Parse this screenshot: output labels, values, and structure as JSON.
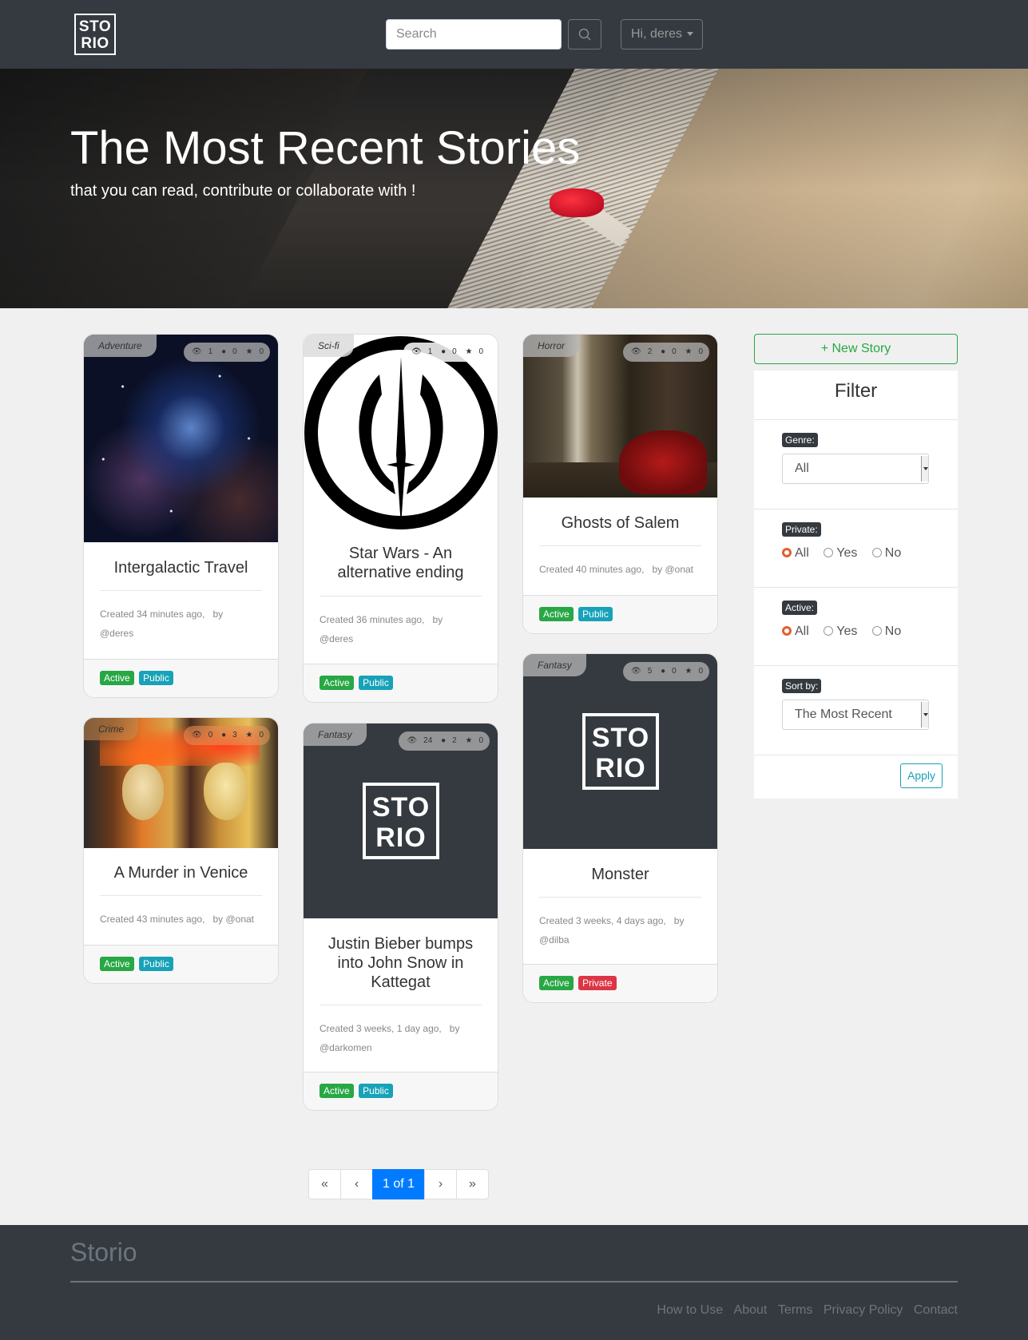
{
  "navbar": {
    "logo_line1": "STO",
    "logo_line2": "RIO",
    "search_placeholder": "Search",
    "user_label": "Hi, deres"
  },
  "hero": {
    "title": "The Most Recent Stories",
    "subtitle": "that you can read, contribute or collaborate with !"
  },
  "cards": [
    {
      "genre": "Adventure",
      "views": "1",
      "comments": "0",
      "stars": "0",
      "title": "Intergalactic Travel",
      "created": "Created 34 minutes ago,",
      "by": "by",
      "author": "@deres",
      "badges": [
        "Active",
        "Public"
      ]
    },
    {
      "genre": "Sci-fi",
      "views": "1",
      "comments": "0",
      "stars": "0",
      "title": "Star Wars - An alternative ending",
      "created": "Created 36 minutes ago,",
      "by": "by",
      "author": "@deres",
      "badges": [
        "Active",
        "Public"
      ]
    },
    {
      "genre": "Horror",
      "views": "2",
      "comments": "0",
      "stars": "0",
      "title": "Ghosts of Salem",
      "created": "Created 40 minutes ago,",
      "by": "by",
      "author": "@onat",
      "badges": [
        "Active",
        "Public"
      ]
    },
    {
      "genre": "Crime",
      "views": "0",
      "comments": "3",
      "stars": "0",
      "title": "A Murder in Venice",
      "created": "Created 43 minutes ago,",
      "by": "by",
      "author": "@onat",
      "badges": [
        "Active",
        "Public"
      ]
    },
    {
      "genre": "Fantasy",
      "views": "24",
      "comments": "2",
      "stars": "0",
      "title": "Justin Bieber bumps into John Snow in Kattegat",
      "created": "Created 3 weeks, 1 day ago,",
      "by": "by",
      "author": "@darkomen",
      "badges": [
        "Active",
        "Public"
      ],
      "logo_line1": "STO",
      "logo_line2": "RIO"
    },
    {
      "genre": "Fantasy",
      "views": "5",
      "comments": "0",
      "stars": "0",
      "title": "Monster",
      "created": "Created 3 weeks, 4 days ago,",
      "by": "by",
      "author": "@dilba",
      "badges": [
        "Active",
        "Private"
      ],
      "logo_line1": "STO",
      "logo_line2": "RIO"
    }
  ],
  "sidebar": {
    "new_story": "+ New Story",
    "filter_title": "Filter",
    "genre_label": "Genre:",
    "genre_value": "All",
    "private_label": "Private:",
    "active_label": "Active:",
    "radio_options": [
      "All",
      "Yes",
      "No"
    ],
    "sort_label": "Sort by:",
    "sort_value": "The Most Recent",
    "apply": "Apply"
  },
  "pagination": {
    "first": "«",
    "prev": "‹",
    "current": "1 of 1",
    "next": "›",
    "last": "»"
  },
  "footer": {
    "brand": "Storio",
    "links": [
      "How to Use",
      "About",
      "Terms",
      "Privacy Policy",
      "Contact"
    ]
  },
  "colors": {
    "navbar": "#343a40",
    "success": "#28a745",
    "info": "#17a2b8",
    "danger": "#dc3545",
    "primary": "#007bff"
  }
}
